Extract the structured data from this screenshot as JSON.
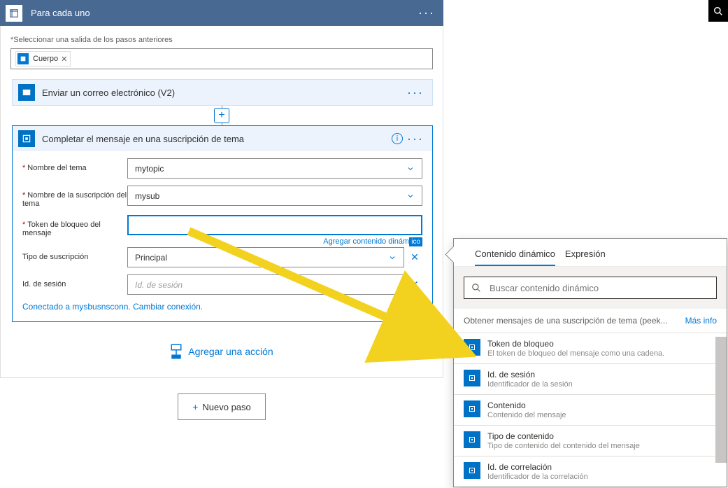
{
  "forEach": {
    "title": "Para cada uno",
    "selectOutputLabel": "*Seleccionar una salida de los pasos anteriores",
    "chipLabel": "Cuerpo"
  },
  "emailAction": {
    "title": "Enviar un correo electrónico (V2)"
  },
  "completeAction": {
    "title": "Completar el mensaje en una suscripción de tema",
    "fields": {
      "topicName": {
        "label": "Nombre del tema",
        "value": "mytopic"
      },
      "subName": {
        "label": "Nombre de la suscripción del tema",
        "value": "mysub"
      },
      "lockToken": {
        "label": "Token de bloqueo del mensaje",
        "value": ""
      },
      "dynLink": "Agregar contenido dinám",
      "subType": {
        "label": "Tipo de suscripción",
        "value": "Principal"
      },
      "sessionId": {
        "label": "Id. de sesión",
        "placeholder": "Id. de sesión"
      }
    },
    "connection": "Conectado a mysbusnsconn. Cambiar conexión."
  },
  "addAction": "Agregar una acción",
  "newStep": "Nuevo paso",
  "dynamicPanel": {
    "tabs": {
      "dynamic": "Contenido dinámico",
      "expression": "Expresión"
    },
    "searchPlaceholder": "Buscar contenido dinámico",
    "category": "Obtener mensajes de una suscripción de tema (peek...",
    "more": "Más info",
    "items": [
      {
        "title": "Token de bloqueo",
        "desc": "El token de bloqueo del mensaje como una cadena."
      },
      {
        "title": "Id. de sesión",
        "desc": "Identificador de la sesión"
      },
      {
        "title": "Contenido",
        "desc": "Contenido del mensaje"
      },
      {
        "title": "Tipo de contenido",
        "desc": "Tipo de contenido del contenido del mensaje"
      },
      {
        "title": "Id. de correlación",
        "desc": "Identificador de la correlación"
      }
    ]
  }
}
